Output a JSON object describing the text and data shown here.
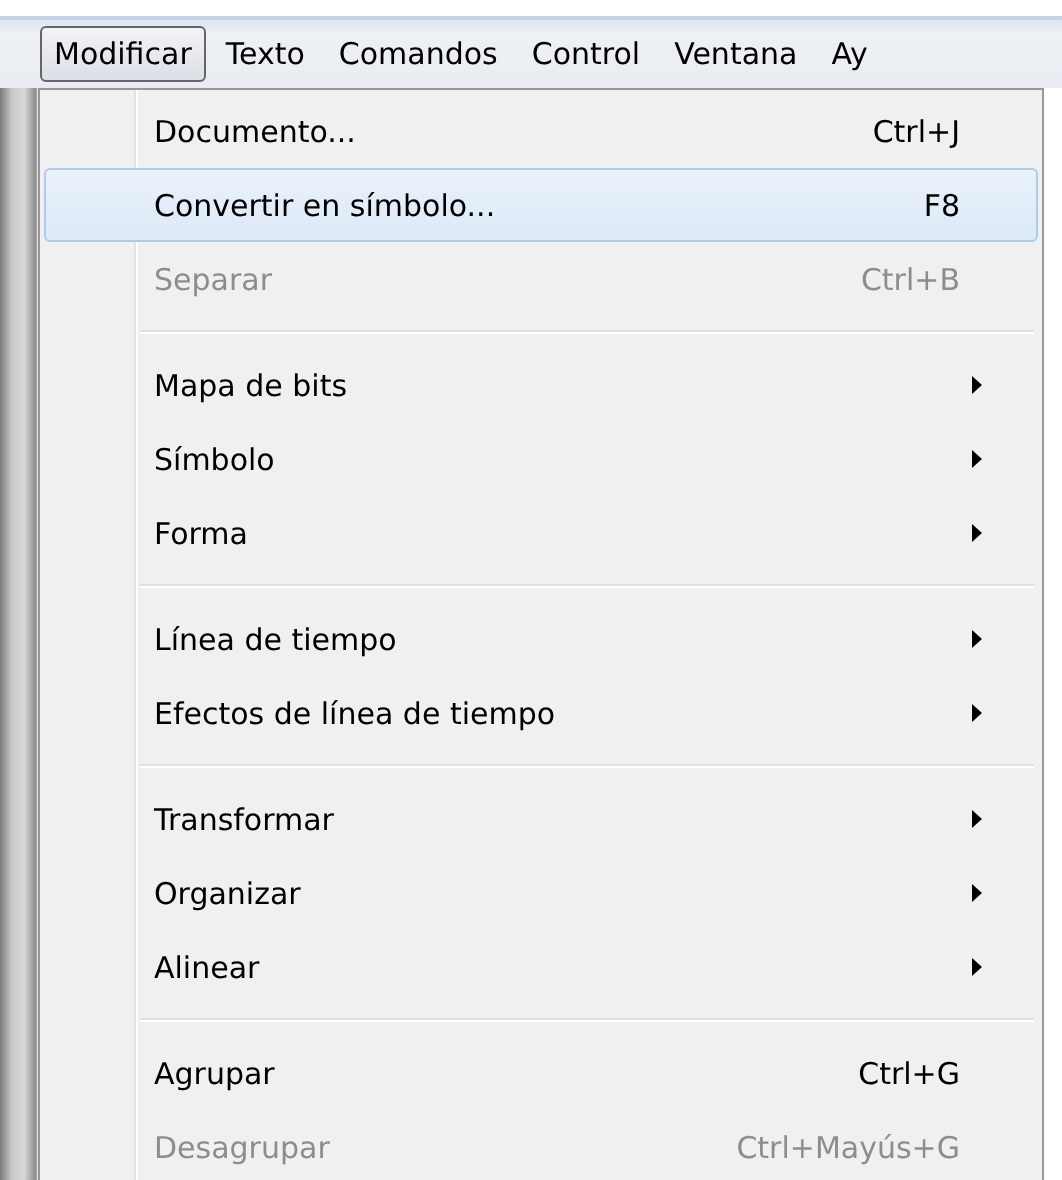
{
  "menubar": [
    {
      "label": "Modificar",
      "selected": true
    },
    {
      "label": "Texto",
      "selected": false
    },
    {
      "label": "Comandos",
      "selected": false
    },
    {
      "label": "Control",
      "selected": false
    },
    {
      "label": "Ventana",
      "selected": false
    },
    {
      "label": "Ay",
      "selected": false
    }
  ],
  "menu": {
    "groups": [
      [
        {
          "label": "Documento...",
          "shortcut": "Ctrl+J",
          "kind": "command",
          "selected": false,
          "disabled": false
        },
        {
          "label": "Convertir en símbolo...",
          "shortcut": "F8",
          "kind": "command",
          "selected": true,
          "disabled": false
        },
        {
          "label": "Separar",
          "shortcut": "Ctrl+B",
          "kind": "command",
          "selected": false,
          "disabled": true
        }
      ],
      [
        {
          "label": "Mapa de bits",
          "kind": "submenu",
          "selected": false,
          "disabled": false
        },
        {
          "label": "Símbolo",
          "kind": "submenu",
          "selected": false,
          "disabled": false
        },
        {
          "label": "Forma",
          "kind": "submenu",
          "selected": false,
          "disabled": false
        }
      ],
      [
        {
          "label": "Línea de tiempo",
          "kind": "submenu",
          "selected": false,
          "disabled": false
        },
        {
          "label": "Efectos de línea de tiempo",
          "kind": "submenu",
          "selected": false,
          "disabled": false
        }
      ],
      [
        {
          "label": "Transformar",
          "kind": "submenu",
          "selected": false,
          "disabled": false
        },
        {
          "label": "Organizar",
          "kind": "submenu",
          "selected": false,
          "disabled": false
        },
        {
          "label": "Alinear",
          "kind": "submenu",
          "selected": false,
          "disabled": false
        }
      ],
      [
        {
          "label": "Agrupar",
          "shortcut": "Ctrl+G",
          "kind": "command",
          "selected": false,
          "disabled": false
        },
        {
          "label": "Desagrupar",
          "shortcut": "Ctrl+Mayús+G",
          "kind": "command",
          "selected": false,
          "disabled": true
        }
      ]
    ]
  }
}
